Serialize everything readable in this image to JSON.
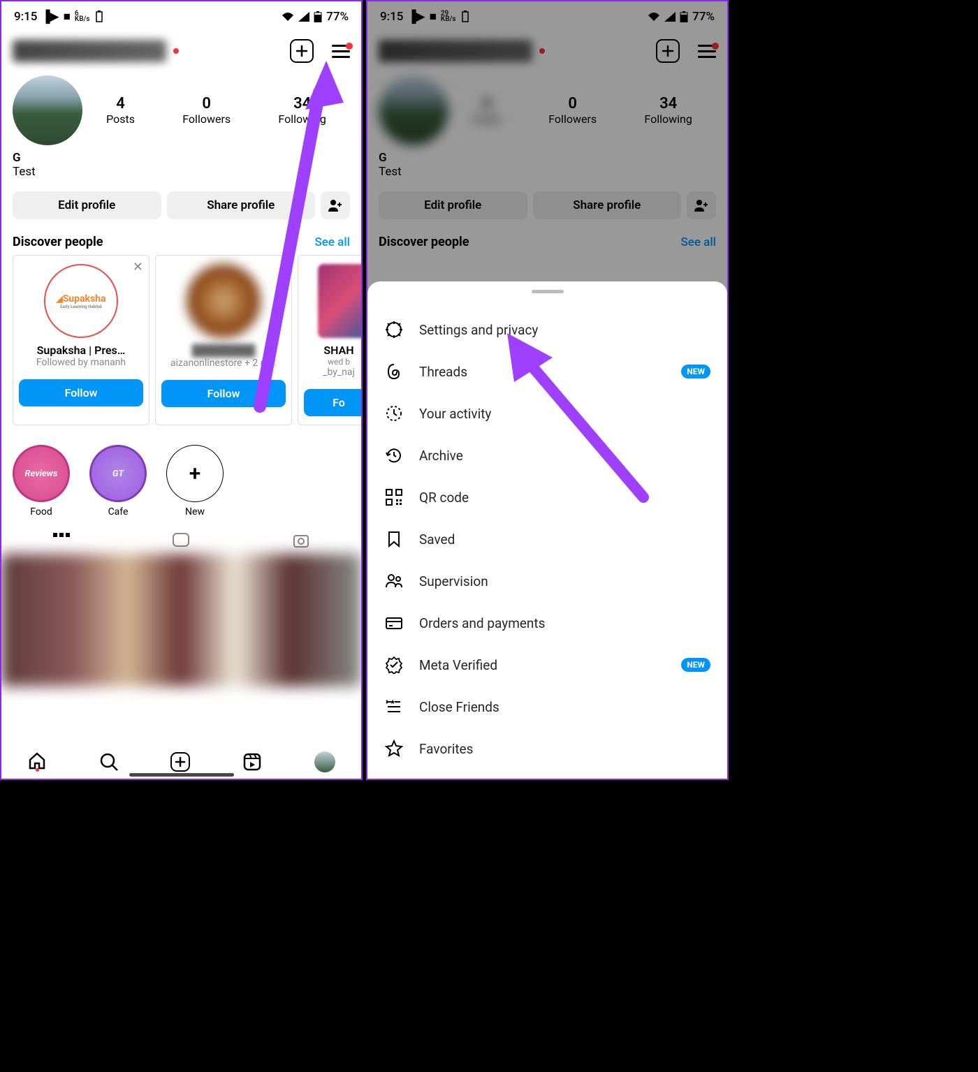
{
  "status": {
    "time": "9:15",
    "kb_left": "6",
    "kb_left_unit": "KB/s",
    "kb_right": "29",
    "kb_right_unit": "KB/s",
    "battery": "77%"
  },
  "profile": {
    "name": "G",
    "bio": "Test",
    "stats": [
      {
        "num": "4",
        "label": "Posts"
      },
      {
        "num": "0",
        "label": "Followers"
      },
      {
        "num": "34",
        "label": "Following"
      }
    ],
    "stats_right": [
      {
        "num": "0",
        "label": "Followers"
      },
      {
        "num": "34",
        "label": "Following"
      }
    ],
    "edit_btn": "Edit profile",
    "share_btn": "Share profile"
  },
  "discover": {
    "title": "Discover people",
    "see_all": "See all",
    "cards": [
      {
        "name": "Supaksha | Pres…",
        "sub": "Followed by mananh",
        "btn": "Follow",
        "avatar_label": "Supaksha",
        "avatar_sub": "Early Learning Habitat"
      },
      {
        "name": "",
        "sub": "aizanonlinestore + 2 m...",
        "btn": "Follow"
      },
      {
        "name": "SHAH",
        "sub": "_by_naj",
        "sub_pre": "wed b",
        "btn": "Fo"
      }
    ]
  },
  "highlights": [
    {
      "label": "Food",
      "text": "Reviews"
    },
    {
      "label": "Cafe",
      "text": "GT"
    },
    {
      "label": "New",
      "text": "+"
    }
  ],
  "menu": [
    {
      "icon": "settings",
      "text": "Settings and privacy"
    },
    {
      "icon": "threads",
      "text": "Threads",
      "badge": "NEW"
    },
    {
      "icon": "activity",
      "text": "Your activity"
    },
    {
      "icon": "archive",
      "text": "Archive"
    },
    {
      "icon": "qr",
      "text": "QR code"
    },
    {
      "icon": "saved",
      "text": "Saved"
    },
    {
      "icon": "supervision",
      "text": "Supervision"
    },
    {
      "icon": "orders",
      "text": "Orders and payments"
    },
    {
      "icon": "meta",
      "text": "Meta Verified",
      "badge": "NEW"
    },
    {
      "icon": "close-friends",
      "text": "Close Friends"
    },
    {
      "icon": "favorites",
      "text": "Favorites"
    }
  ]
}
